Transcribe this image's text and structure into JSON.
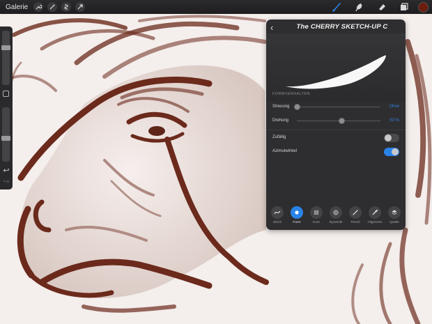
{
  "topbar": {
    "gallery_label": "Galerie",
    "left_icons": [
      "wrench-icon",
      "magic-wand-icon",
      "selection-icon",
      "transform-arrow-icon"
    ],
    "right_tools": [
      "brush-icon",
      "smudge-icon",
      "eraser-icon",
      "layers-icon"
    ],
    "active_tool": "brush-icon",
    "active_tool_color": "#2a84e8",
    "current_color": "#6b1d10"
  },
  "sidebar": {
    "size_slider_value": 0.3,
    "opacity_slider_value": 0.58,
    "undo_symbol": "↩",
    "redo_symbol": "↪"
  },
  "brush_panel": {
    "back_symbol": "‹",
    "title": "The CHERRY SKETCH-UP C",
    "section_label": "FORMVERHALTEN",
    "rows": [
      {
        "label": "Streuung",
        "value": "Ohne",
        "position": 0.0
      },
      {
        "label": "Drehung",
        "value": "53 %",
        "position": 0.53
      }
    ],
    "toggles": [
      {
        "label": "Zufällig",
        "on": false
      },
      {
        "label": "Azimutwinkel",
        "on": true
      }
    ],
    "accent_color": "#2a84e8",
    "tabs": [
      {
        "label": "Strich",
        "icon": "stroke-icon",
        "active": false
      },
      {
        "label": "Form",
        "icon": "shape-icon",
        "active": true
      },
      {
        "label": "Korn",
        "icon": "grain-icon",
        "active": false
      },
      {
        "label": "Dynamik",
        "icon": "dynamics-icon",
        "active": false
      },
      {
        "label": "Pencil",
        "icon": "pencil-icon",
        "active": false
      },
      {
        "label": "Allgemein",
        "icon": "general-icon",
        "active": false
      },
      {
        "label": "Quelle",
        "icon": "source-icon",
        "active": false
      }
    ]
  }
}
